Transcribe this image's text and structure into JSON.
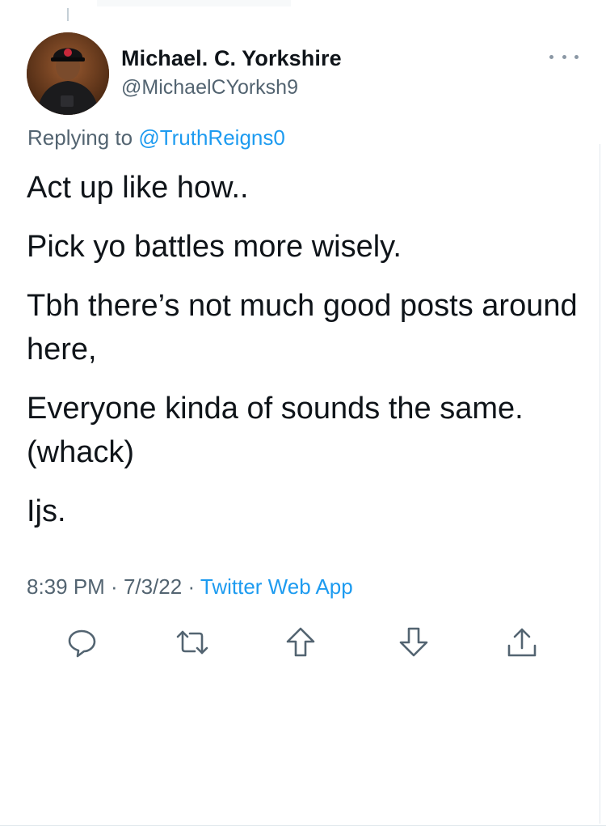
{
  "author": {
    "display_name": "Michael. C. Yorkshire",
    "handle": "@MichaelCYorksh9"
  },
  "reply": {
    "prefix": "Replying to",
    "mention": "@TruthReigns0"
  },
  "tweet": {
    "paragraphs": [
      "Act up like how..",
      "Pick yo battles more wisely.",
      "Tbh there’s not much good posts around here,",
      "Everyone kinda of sounds the same. (whack)",
      "Ijs."
    ]
  },
  "meta": {
    "time": "8:39 PM",
    "sep1": " · ",
    "date": "7/3/22",
    "sep2": " · ",
    "source": "Twitter Web App"
  },
  "actions": {
    "icons": [
      "reply-icon",
      "retweet-icon",
      "upvote-icon",
      "downvote-icon",
      "share-icon"
    ]
  },
  "colors": {
    "accent": "#1d9bf0",
    "secondary_text": "#536471",
    "primary_text": "#0f1419"
  }
}
